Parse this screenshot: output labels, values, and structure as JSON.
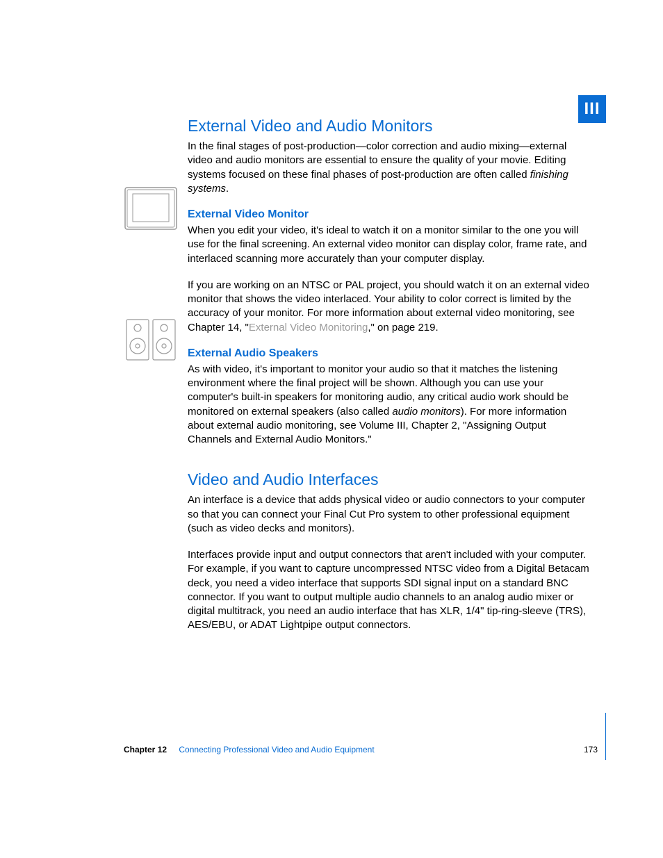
{
  "tab": {
    "label": "III"
  },
  "section1": {
    "heading": "External Video and Audio Monitors",
    "intro_pre": "In the final stages of post-production—color correction and audio mixing—external video and audio monitors are essential to ensure the quality of your movie. Editing systems focused on these final phases of post-production are often called ",
    "intro_italic": "finishing systems",
    "intro_post": ".",
    "sub1": {
      "heading": "External Video Monitor",
      "p1": "When you edit your video, it's ideal to watch it on a monitor similar to the one you will use for the final screening. An external video monitor can display color, frame rate, and interlaced scanning more accurately than your computer display.",
      "p2_pre": "If you are working on an NTSC or PAL project, you should watch it on an external video monitor that shows the video interlaced. Your ability to color correct is limited by the accuracy of your monitor. For more information about external video monitoring, see Chapter 14, \"",
      "p2_link": "External Video Monitoring",
      "p2_post": ",\" on page 219."
    },
    "sub2": {
      "heading": "External Audio Speakers",
      "p1_pre": "As with video, it's important to monitor your audio so that it matches the listening environment where the final project will be shown. Although you can use your computer's built-in speakers for monitoring audio, any critical audio work should be monitored on external speakers (also called ",
      "p1_italic": "audio monitors",
      "p1_post": "). For more information about external audio monitoring, see Volume III, Chapter 2, \"Assigning Output Channels and External Audio Monitors.\""
    }
  },
  "section2": {
    "heading": "Video and Audio Interfaces",
    "p1": "An interface is a device that adds physical video or audio connectors to your computer so that you can connect your Final Cut Pro system to other professional equipment (such as video decks and monitors).",
    "p2": "Interfaces provide input and output connectors that aren't included with your computer. For example, if you want to capture uncompressed NTSC video from a Digital Betacam deck, you need a video interface that supports SDI signal input on a standard BNC connector. If you want to output multiple audio channels to an analog audio mixer or digital multitrack, you need an audio interface that has XLR, 1/4\" tip-ring-sleeve (TRS), AES/EBU, or ADAT Lightpipe output connectors."
  },
  "footer": {
    "chapter_label": "Chapter 12",
    "chapter_title": "Connecting Professional Video and Audio Equipment",
    "page_number": "173"
  }
}
